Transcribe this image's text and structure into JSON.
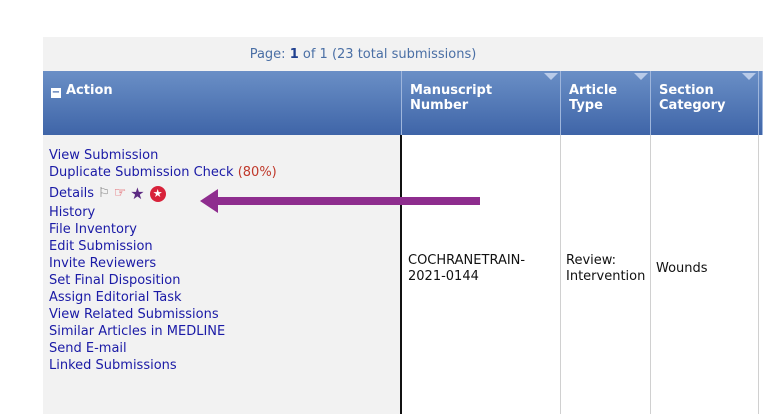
{
  "pager": {
    "prefix": "Page:",
    "current": "1",
    "of_label": "of",
    "total_pages": "1",
    "total_text": "(23 total submissions)"
  },
  "columns": [
    {
      "label": "Action"
    },
    {
      "label": "Manuscript Number"
    },
    {
      "label": "Article Type"
    },
    {
      "label": "Section Category"
    }
  ],
  "actions": {
    "view_submission": "View Submission",
    "duplicate_check": "Duplicate Submission Check",
    "duplicate_pct": "(80%)",
    "details": "Details",
    "items": [
      "History",
      "File Inventory",
      "Edit Submission",
      "Invite Reviewers",
      "Set Final Disposition",
      "Assign Editorial Task",
      "View Related Submissions",
      "Similar Articles in MEDLINE",
      "Send E-mail",
      "Linked Submissions"
    ]
  },
  "row": {
    "manuscript_line1": "COCHRANETRAIN-",
    "manuscript_line2": "2021-0144",
    "article_type_line1": "Review:",
    "article_type_line2": "Intervention",
    "section_category": "Wounds"
  },
  "icons": {
    "flag": "flag-icon",
    "hand": "pointing-hand-icon",
    "star": "star-icon",
    "badge": "star-badge-icon"
  },
  "colors": {
    "header_top": "#6a8fc6",
    "header_bottom": "#3f65a8",
    "link": "#1a1aa6",
    "percent": "#c0392b",
    "annotation_arrow": "#8e2d8e"
  }
}
